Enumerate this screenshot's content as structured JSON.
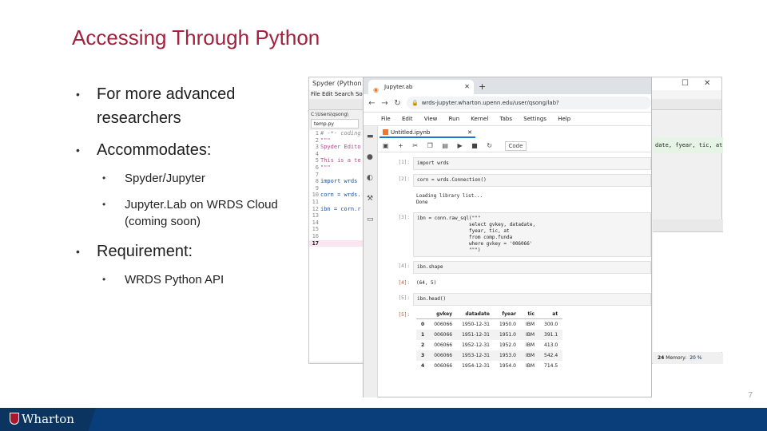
{
  "slide": {
    "title": "Accessing Through Python",
    "page_number": "7",
    "bullets": [
      {
        "text": "For more advanced researchers"
      },
      {
        "text": "Accommodates:"
      },
      {
        "text": "Requirement:"
      }
    ],
    "sub_bullets": {
      "accommodates": [
        "Spyder/Jupyter",
        "Jupyter.Lab on WRDS Cloud (coming soon)"
      ],
      "requirement": [
        "WRDS Python API"
      ]
    },
    "logo_text": "Wharton"
  },
  "spyder": {
    "title": "Spyder (Python 3",
    "menu": "File  Edit  Search  So",
    "path": "C:\\Users\\qsong\\",
    "tab": "temp.py",
    "lines": [
      {
        "n": "1",
        "t": "# -*- coding"
      },
      {
        "n": "2",
        "t": "\"\"\""
      },
      {
        "n": "3",
        "t": "Spyder Edito"
      },
      {
        "n": "4",
        "t": ""
      },
      {
        "n": "5",
        "t": "This is a te"
      },
      {
        "n": "6",
        "t": "\"\"\""
      },
      {
        "n": "7",
        "t": ""
      },
      {
        "n": "8",
        "t": "import wrds"
      },
      {
        "n": "9",
        "t": ""
      },
      {
        "n": "10",
        "t": "corn = wrds."
      },
      {
        "n": "11",
        "t": ""
      },
      {
        "n": "12",
        "t": "ibn = corn.r"
      },
      {
        "n": "13",
        "t": ""
      },
      {
        "n": "14",
        "t": ""
      },
      {
        "n": "15",
        "t": ""
      },
      {
        "n": "16",
        "t": ""
      },
      {
        "n": "17",
        "t": ""
      }
    ],
    "right_strip": "date, fyear, tic, at",
    "status_lines": "24",
    "status_memory_label": "Memory:",
    "status_memory_value": "20 %"
  },
  "jupyter": {
    "tab_title": "Jupyter.ab",
    "url": "wrds-jupyter.wharton.upenn.edu/user/qsong/lab?",
    "menu": [
      "File",
      "Edit",
      "View",
      "Run",
      "Kernel",
      "Tabs",
      "Settings",
      "Help"
    ],
    "notebook_tab": "Untitled.ipynb",
    "cell_type": "Code",
    "cells": [
      {
        "prompt": "[1]:",
        "input": "import wrds"
      },
      {
        "prompt": "[2]:",
        "input": "corn = wrds.Connection()",
        "output": "Loading library list...\nDone"
      },
      {
        "prompt": "[3]:",
        "input": "ibn = conn.raw_sql(\"\"\"\n                  select gvkey, datadate,\n                  fyear, tic, at\n                  from comp.funda\n                  where gvkey = '006066'\n                  \"\"\")"
      },
      {
        "prompt": "[4]:",
        "input": "ibn.shape"
      },
      {
        "prompt": "[4]:",
        "out": true,
        "output": "(64, 5)"
      },
      {
        "prompt": "[5]:",
        "input": "ibn.head()"
      }
    ],
    "table": {
      "prompt": "[5]:",
      "columns": [
        "",
        "gvkey",
        "datadate",
        "fyear",
        "tic",
        "at"
      ],
      "rows": [
        [
          "0",
          "006066",
          "1950-12-31",
          "1950.0",
          "IBM",
          "300.0"
        ],
        [
          "1",
          "006066",
          "1951-12-31",
          "1951.0",
          "IBM",
          "391.1"
        ],
        [
          "2",
          "006066",
          "1952-12-31",
          "1952.0",
          "IBM",
          "413.0"
        ],
        [
          "3",
          "006066",
          "1953-12-31",
          "1953.0",
          "IBM",
          "542.4"
        ],
        [
          "4",
          "006066",
          "1954-12-31",
          "1954.0",
          "IBM",
          "714.5"
        ]
      ]
    }
  }
}
